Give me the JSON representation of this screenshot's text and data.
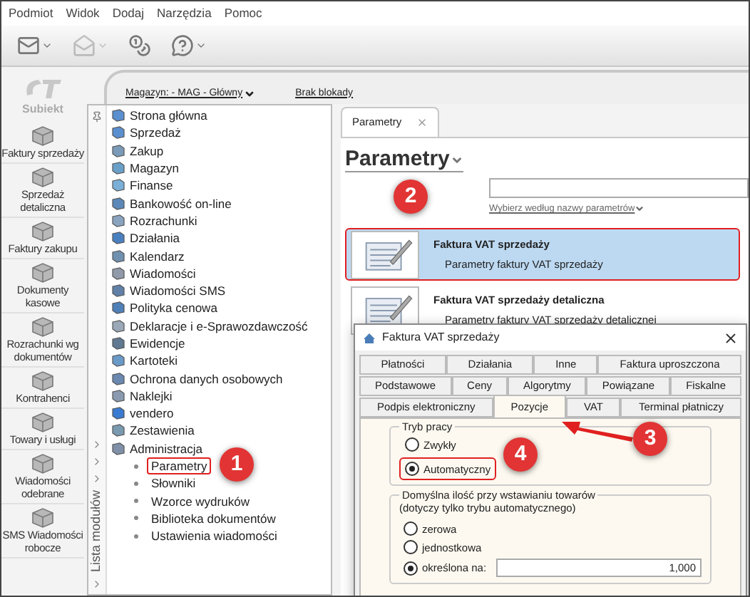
{
  "menu": [
    "Podmiot",
    "Widok",
    "Dodaj",
    "Narzędzia",
    "Pomoc"
  ],
  "logo": {
    "text": "Subiekt"
  },
  "sidebar": {
    "items": [
      {
        "label": "Faktury sprzedaży"
      },
      {
        "label": "Sprzedaż detaliczna"
      },
      {
        "label": "Faktury zakupu"
      },
      {
        "label": "Dokumenty kasowe"
      },
      {
        "label": "Rozrachunki wg dokumentów"
      },
      {
        "label": "Kontrahenci"
      },
      {
        "label": "Towary i usługi"
      },
      {
        "label": "Wiadomości odebrane"
      },
      {
        "label": "SMS Wiadomości robocze"
      }
    ]
  },
  "header": {
    "warehouse_link": "Magazyn: - MAG - Główny",
    "lock_link": "Brak blokady"
  },
  "module_panel": {
    "title": "Lista modułów",
    "tree": [
      {
        "label": "Strona główna"
      },
      {
        "label": "Sprzedaż"
      },
      {
        "label": "Zakup"
      },
      {
        "label": "Magazyn"
      },
      {
        "label": "Finanse"
      },
      {
        "label": "Bankowość on-line"
      },
      {
        "label": "Rozrachunki"
      },
      {
        "label": "Działania"
      },
      {
        "label": "Kalendarz"
      },
      {
        "label": "Wiadomości"
      },
      {
        "label": "Wiadomości SMS"
      },
      {
        "label": "Polityka cenowa"
      },
      {
        "label": "Deklaracje i e-Sprawozdawczość"
      },
      {
        "label": "Ewidencje"
      },
      {
        "label": "Kartoteki"
      },
      {
        "label": "Ochrona danych osobowych"
      },
      {
        "label": "Naklejki"
      },
      {
        "label": "vendero"
      },
      {
        "label": "Zestawienia"
      },
      {
        "label": "Administracja",
        "children": [
          {
            "label": "Parametry",
            "annotated": true
          },
          {
            "label": "Słowniki",
            "annotated": false
          },
          {
            "label": "Wzorce wydruków",
            "annotated": false
          },
          {
            "label": "Biblioteka dokumentów",
            "annotated": false
          },
          {
            "label": "Ustawienia wiadomości",
            "annotated": false
          }
        ]
      }
    ]
  },
  "tab": {
    "label": "Parametry"
  },
  "page_title": "Parametry",
  "search": {
    "filter_link": "Wybierz według nazwy parametrów"
  },
  "parameters": [
    {
      "title": "Faktura VAT sprzedaży",
      "description": "Parametry faktury VAT sprzedaży",
      "selected": true,
      "annotated": true
    },
    {
      "title": "Faktura VAT sprzedaży detaliczna",
      "description": "Parametry faktury VAT sprzedaży detalicznej",
      "selected": false,
      "annotated": false
    }
  ],
  "dialog": {
    "title": "Faktura VAT sprzedaży",
    "tab_rows": [
      [
        {
          "label": "Płatności",
          "selected": false
        },
        {
          "label": "Działania",
          "selected": false
        },
        {
          "label": "Inne",
          "selected": false
        },
        {
          "label": "Faktura uproszczona",
          "selected": false
        }
      ],
      [
        {
          "label": "Podstawowe",
          "selected": false
        },
        {
          "label": "Ceny",
          "selected": false
        },
        {
          "label": "Algorytmy",
          "selected": false
        },
        {
          "label": "Powiązane",
          "selected": false
        },
        {
          "label": "Fiskalne",
          "selected": false
        }
      ],
      [
        {
          "label": "Podpis elektroniczny",
          "selected": false
        },
        {
          "label": "Pozycje",
          "selected": true
        },
        {
          "label": "VAT",
          "selected": false
        },
        {
          "label": "Terminal płatniczy",
          "selected": false
        }
      ]
    ],
    "mode_group": {
      "legend": "Tryb pracy",
      "options": [
        {
          "label": "Zwykły",
          "selected": false,
          "annotated": false
        },
        {
          "label": "Automatyczny",
          "selected": true,
          "annotated": true
        }
      ]
    },
    "quantity_group": {
      "legend": "Domyślna ilość przy wstawianiu towarów",
      "note": "(dotyczy tylko trybu automatycznego)",
      "options": [
        {
          "label": "zerowa",
          "selected": false
        },
        {
          "label": "jednostkowa",
          "selected": false
        },
        {
          "label": "określona na:",
          "selected": true,
          "value": "1,000"
        }
      ]
    }
  },
  "callouts": [
    "1",
    "2",
    "3",
    "4"
  ]
}
